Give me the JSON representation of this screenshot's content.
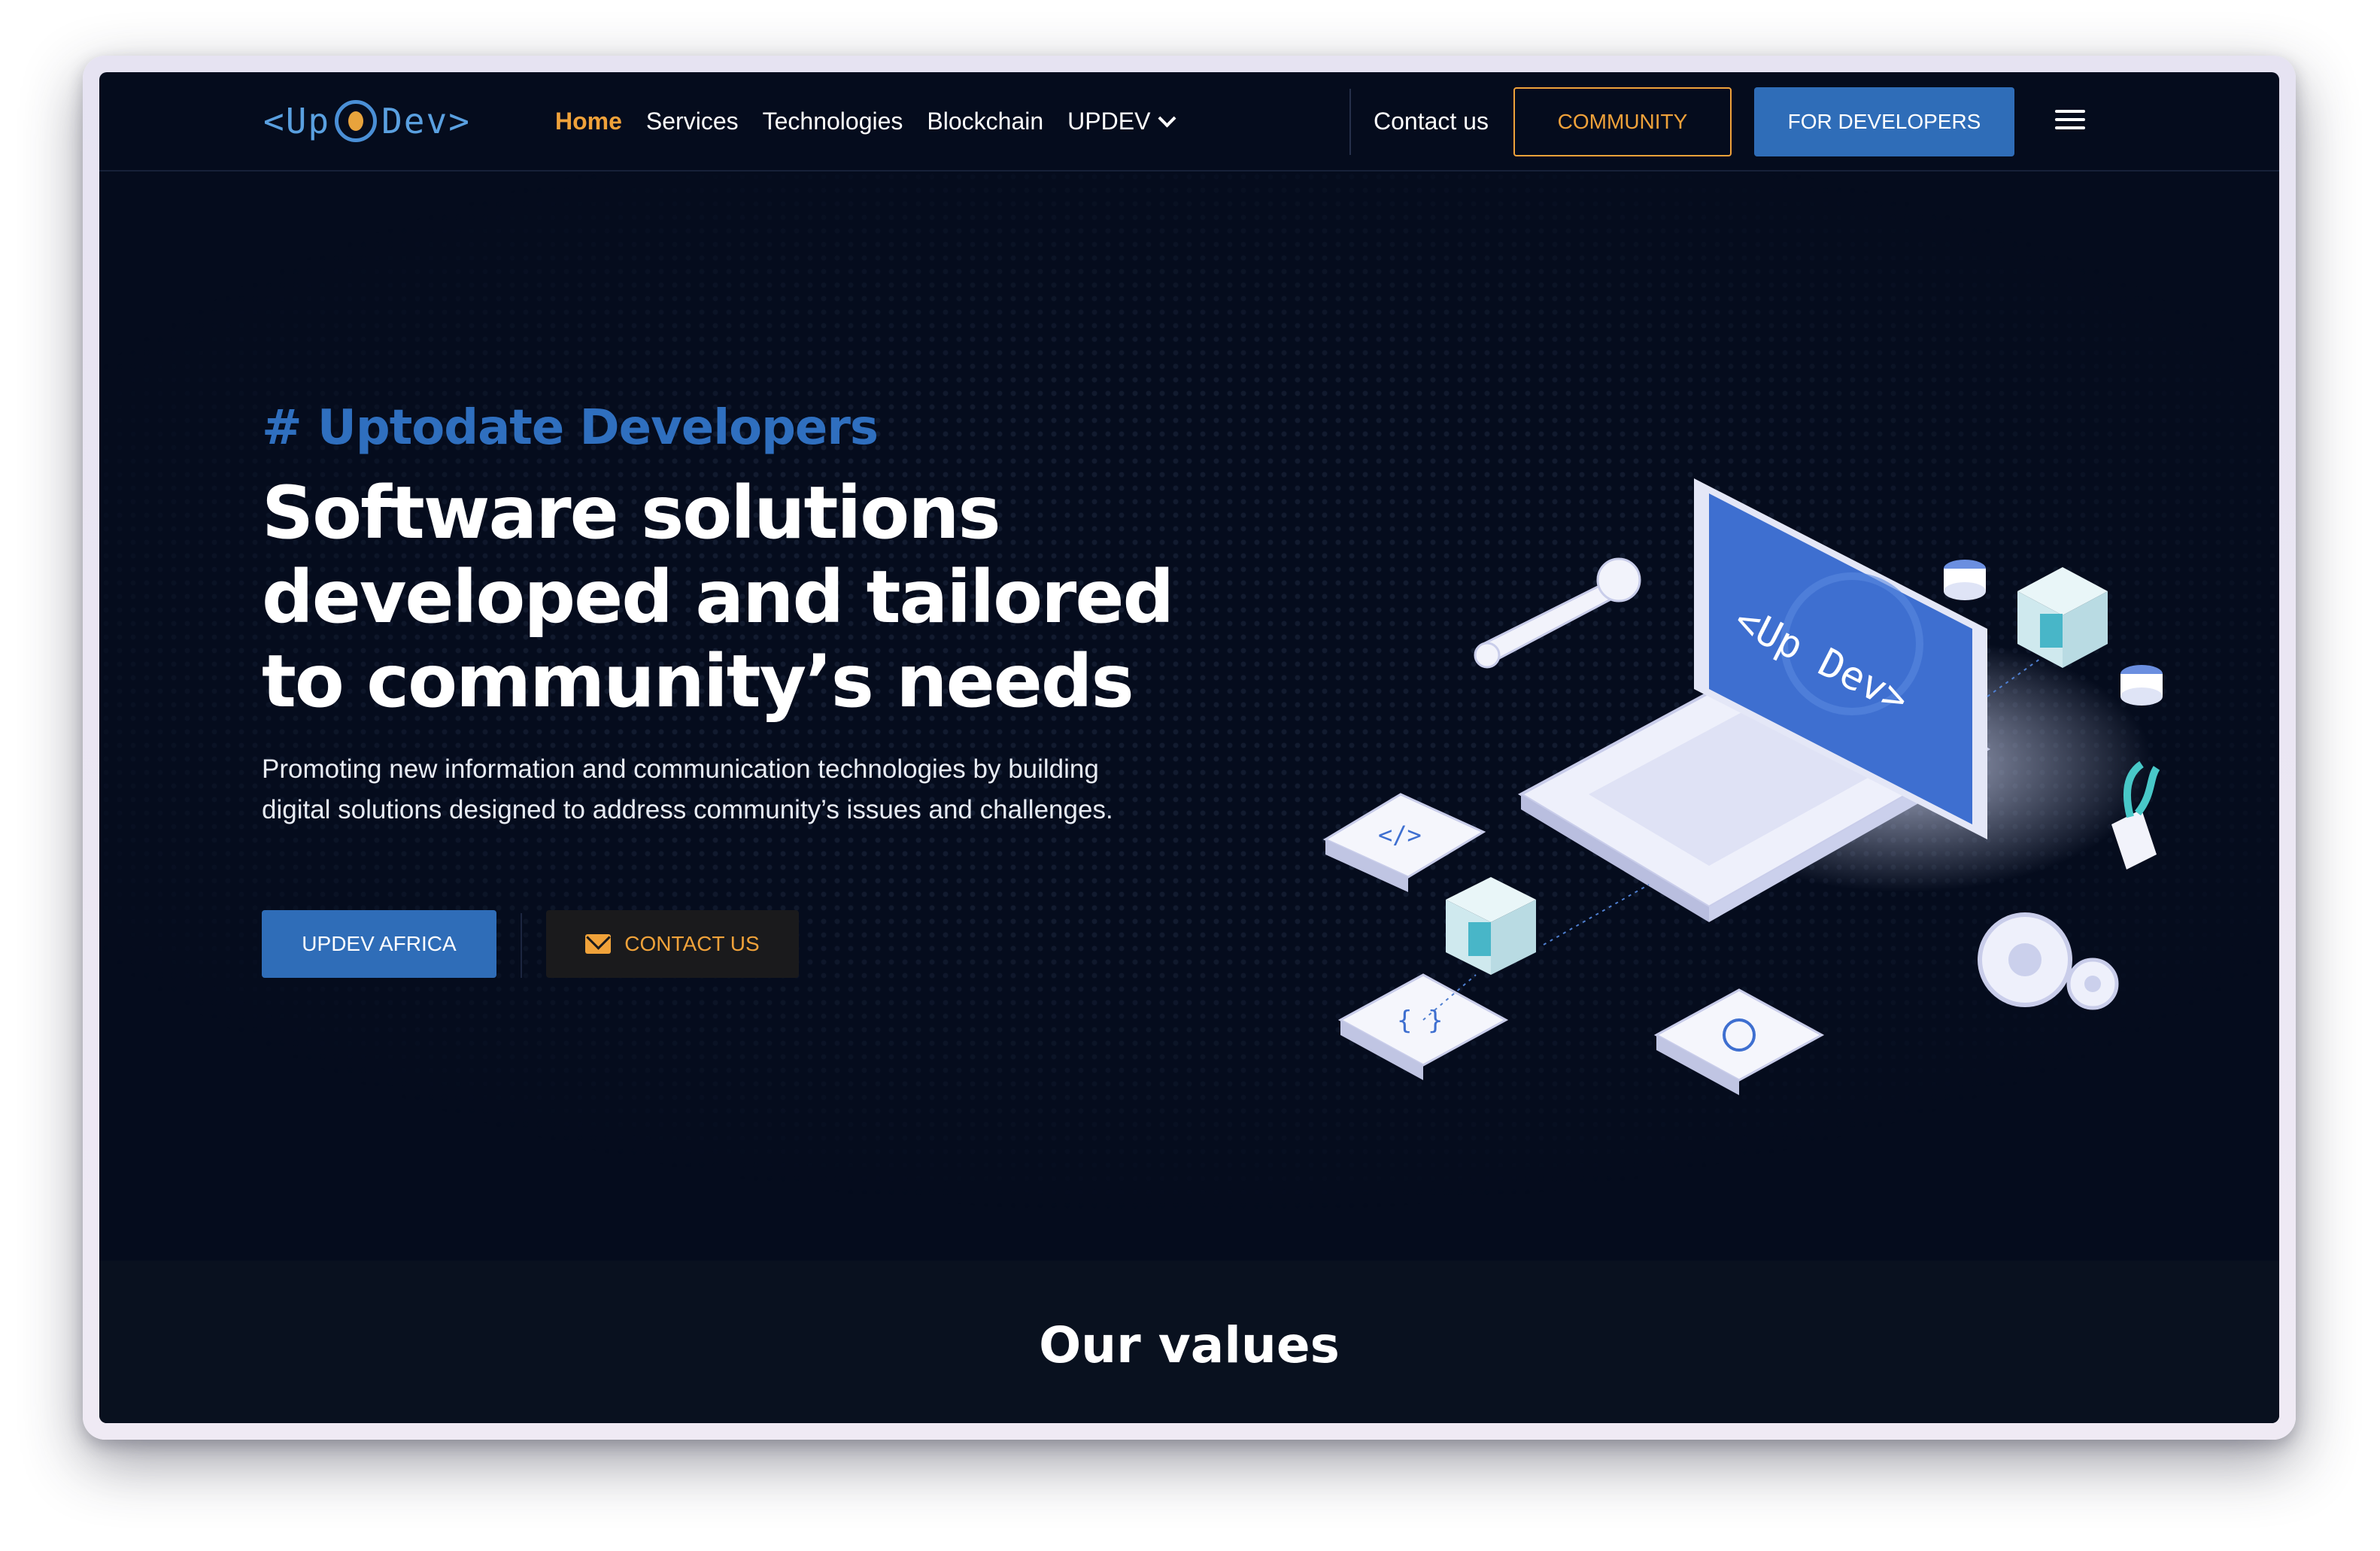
{
  "logo": {
    "left": "<",
    "text_up": "Up",
    "text_dev": "Dev",
    "right": ">"
  },
  "nav": {
    "links": [
      "Home",
      "Services",
      "Technologies",
      "Blockchain",
      "UPDEV"
    ],
    "contact": "Contact us",
    "community": "COMMUNITY",
    "developers": "FOR DEVELOPERS",
    "menu_icon": "hamburger-icon"
  },
  "hero": {
    "tagline": "# Uptodate Developers",
    "headline": "Software solutions developed and tailored to community’s needs",
    "subtext": "Promoting new information and communication technologies by building digital solutions designed to address community’s issues and challenges.",
    "primary_button": "UPDEV AFRICA",
    "secondary_button": "CONTACT US",
    "secondary_icon": "mail-icon"
  },
  "illustration": {
    "screen_text": "<Up  Dev>",
    "tile_code": "</>",
    "tile_braces": "{ }"
  },
  "values": {
    "title": "Our values"
  },
  "colors": {
    "accent": "#f0a23a",
    "brand_blue": "#2f6db8",
    "background": "#050c1d"
  }
}
